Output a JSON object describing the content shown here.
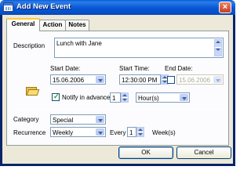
{
  "window": {
    "title": "Add New Event"
  },
  "tabs": [
    {
      "label": "General"
    },
    {
      "label": "Action"
    },
    {
      "label": "Notes"
    }
  ],
  "general": {
    "description_label": "Description",
    "description_value": "Lunch with Jane",
    "start_date_label": "Start Date:",
    "start_date_value": "15.06.2006",
    "start_time_label": "Start Time:",
    "start_time_value": "12:30:00 PM",
    "end_date_label": "End Date:",
    "end_date_value": "15.06.2006",
    "notify_label": "Notify in advance",
    "notify_amount": "1",
    "notify_unit": "Hour(s)",
    "category_label": "Category",
    "category_value": "Special",
    "recurrence_label": "Recurrence",
    "recurrence_value": "Weekly",
    "every_label": "Every",
    "every_value": "1",
    "every_unit": "Week(s)"
  },
  "buttons": {
    "ok": "OK",
    "cancel": "Cancel"
  },
  "icons": {
    "app": "calendar-icon",
    "event": "folder-open-icon",
    "close": "close-icon"
  },
  "colors": {
    "titlebar": "#0a58d2",
    "client": "#ece9d8",
    "tab_highlight": "#ffc83c"
  }
}
